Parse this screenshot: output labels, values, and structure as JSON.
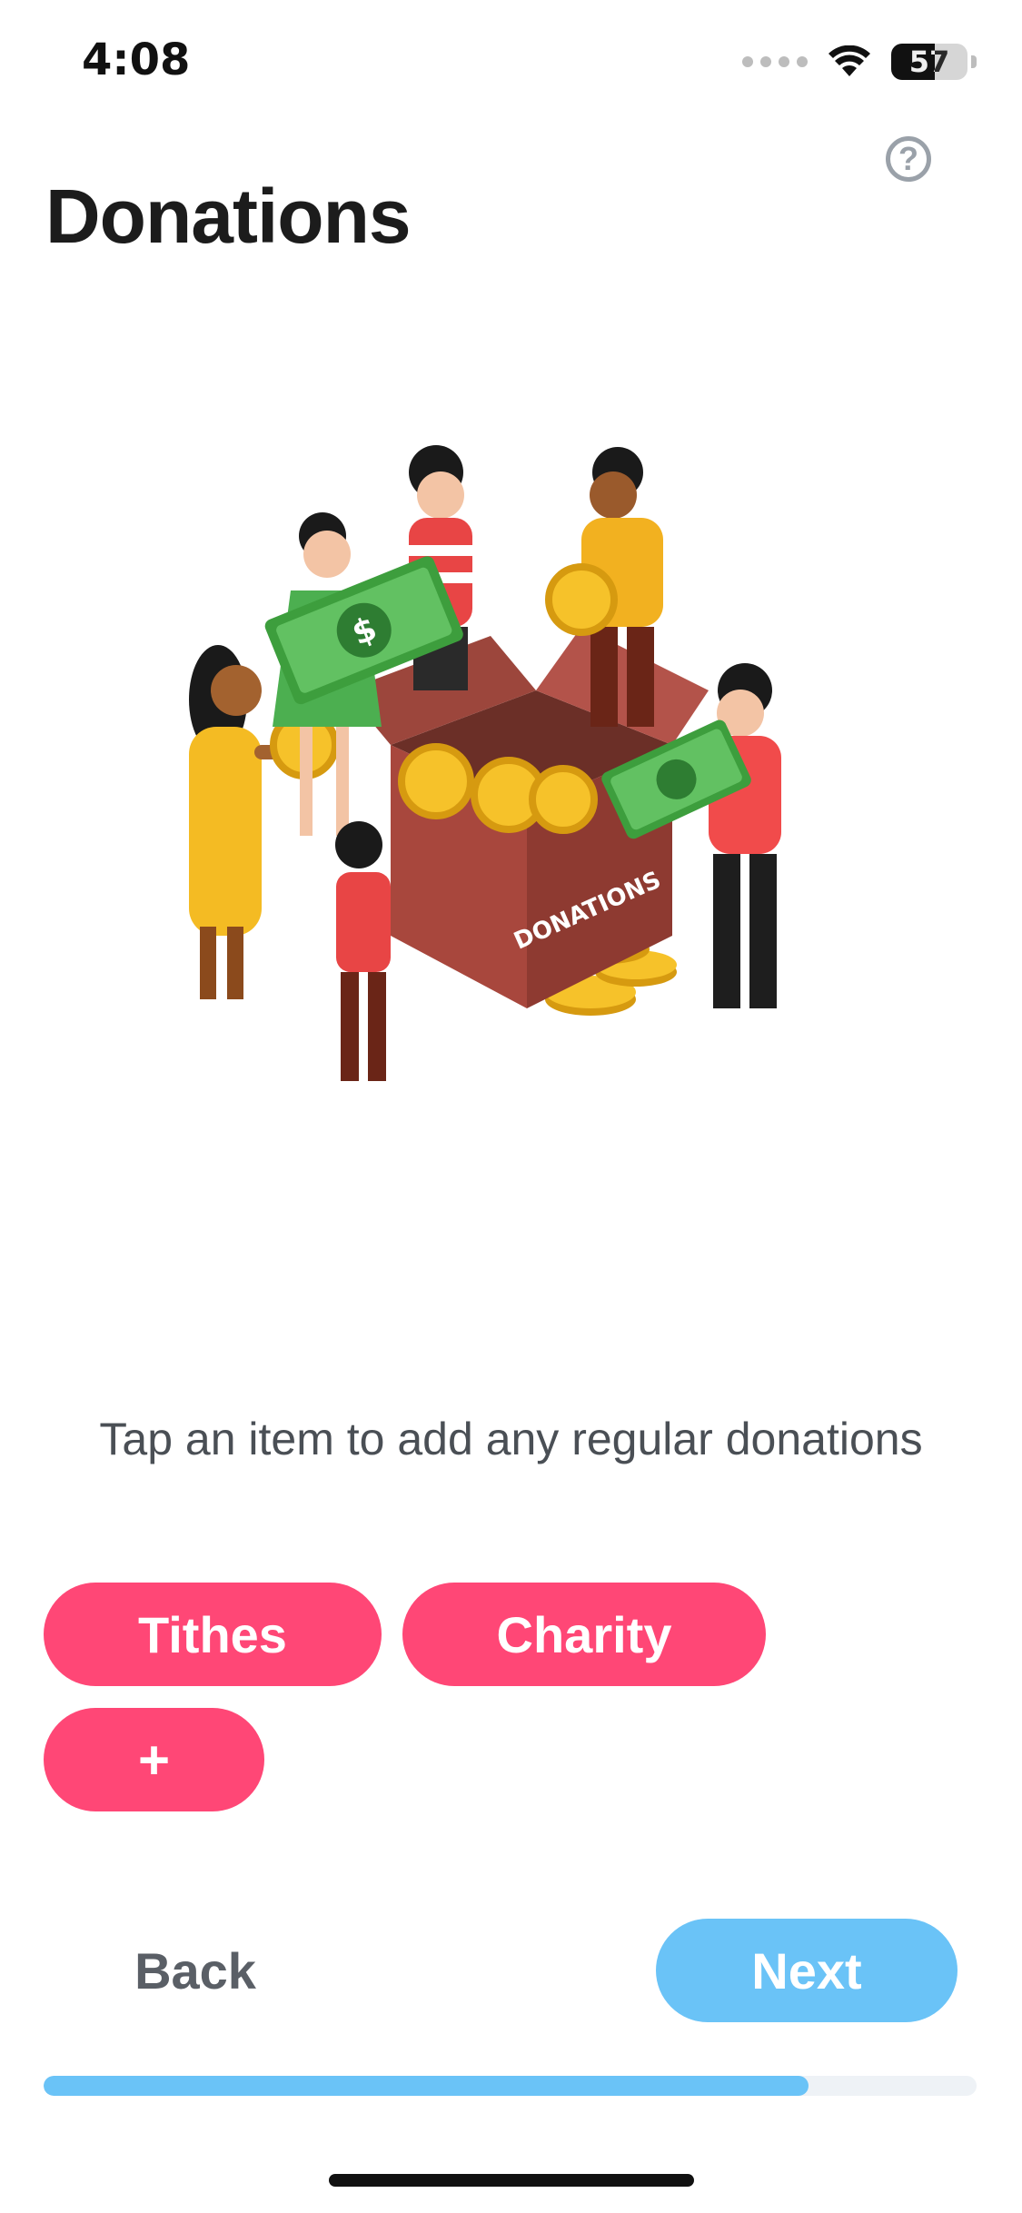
{
  "status_bar": {
    "time": "4:08",
    "battery_level": "57",
    "signal_icon": "signal-dots-icon",
    "wifi_icon": "wifi-icon",
    "battery_icon": "battery-icon"
  },
  "header": {
    "title": "Donations",
    "help_icon": "question-circle-icon",
    "help_glyph": "?"
  },
  "illustration": {
    "box_label": "DONATIONS",
    "money_symbol": "$"
  },
  "instruction": "Tap an item to add any regular donations",
  "chips": [
    {
      "label": "Tithes"
    },
    {
      "label": "Charity"
    },
    {
      "label": "+"
    }
  ],
  "footer": {
    "back_label": "Back",
    "next_label": "Next",
    "progress_fraction": 0.82
  },
  "colors": {
    "chip": "#ff4776",
    "next_button": "#6ac3f7",
    "progress": "#6ac3f7",
    "progress_track": "#eef2f6",
    "title": "#1c1c1c",
    "back_text": "#5a5f66"
  }
}
